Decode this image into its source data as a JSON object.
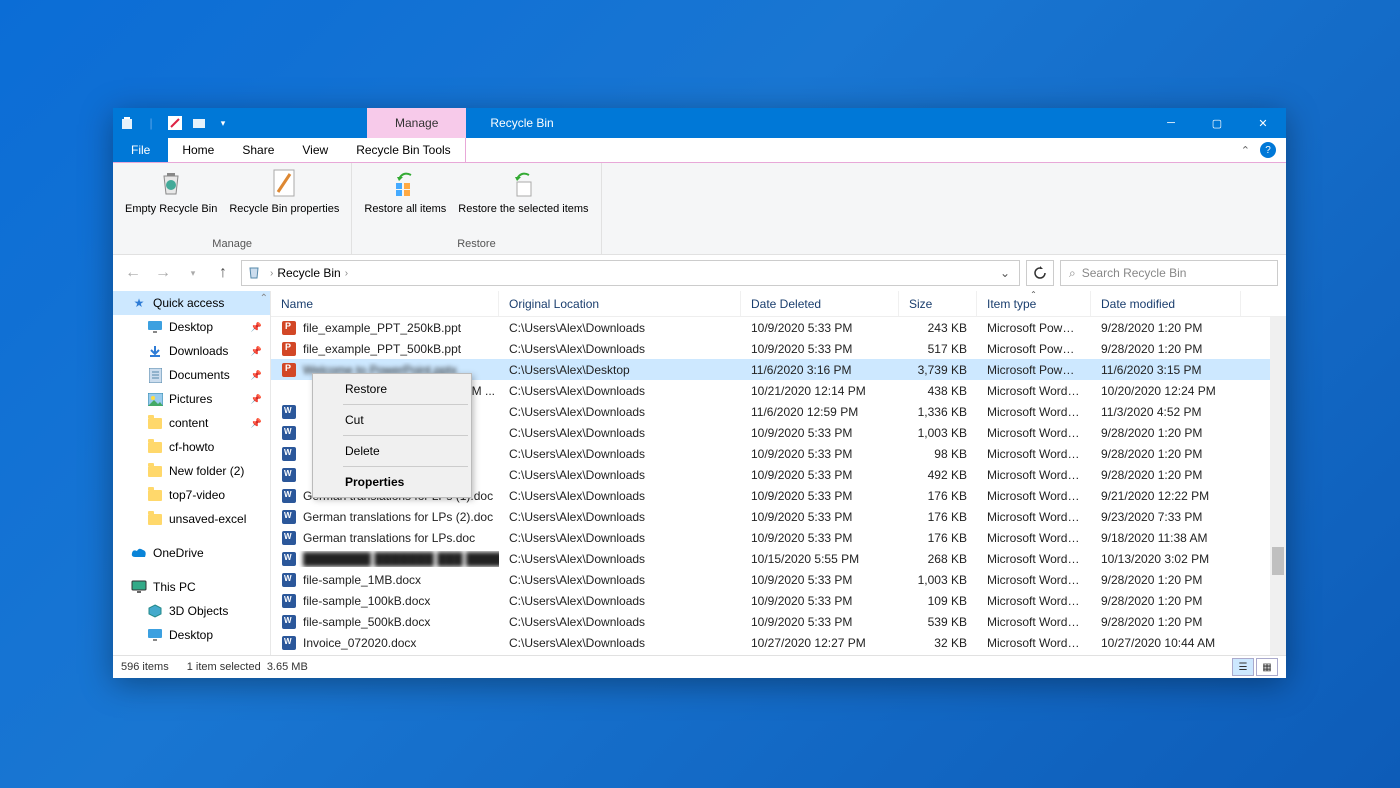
{
  "title": "Recycle Bin",
  "manage_tab": "Manage",
  "ribbon_tabs": {
    "file": "File",
    "home": "Home",
    "share": "Share",
    "view": "View",
    "tools": "Recycle Bin Tools"
  },
  "ribbon": {
    "empty": "Empty Recycle Bin",
    "props": "Recycle Bin properties",
    "restore_all": "Restore all items",
    "restore_sel": "Restore the selected items",
    "group_manage": "Manage",
    "group_restore": "Restore"
  },
  "breadcrumb": [
    "Recycle Bin"
  ],
  "search_placeholder": "Search Recycle Bin",
  "sidebar": {
    "quick": "Quick access",
    "items": [
      {
        "label": "Desktop",
        "icon": "desktop",
        "pin": true
      },
      {
        "label": "Downloads",
        "icon": "down",
        "pin": true
      },
      {
        "label": "Documents",
        "icon": "doc",
        "pin": true
      },
      {
        "label": "Pictures",
        "icon": "pic",
        "pin": true
      },
      {
        "label": "content",
        "icon": "folder",
        "pin": true
      },
      {
        "label": "cf-howto",
        "icon": "folder",
        "pin": false
      },
      {
        "label": "New folder (2)",
        "icon": "folder",
        "pin": false
      },
      {
        "label": "top7-video",
        "icon": "folder",
        "pin": false
      },
      {
        "label": "unsaved-excel",
        "icon": "folder",
        "pin": false
      }
    ],
    "onedrive": "OneDrive",
    "thispc": "This PC",
    "thispc_items": [
      {
        "label": "3D Objects",
        "icon": "3d"
      },
      {
        "label": "Desktop",
        "icon": "desktop"
      }
    ]
  },
  "columns": {
    "name": "Name",
    "loc": "Original Location",
    "del": "Date Deleted",
    "size": "Size",
    "type": "Item type",
    "mod": "Date modified"
  },
  "rows": [
    {
      "icon": "ppt",
      "name": "file_example_PPT_250kB.ppt",
      "loc": "C:\\Users\\Alex\\Downloads",
      "del": "10/9/2020 5:33 PM",
      "size": "243 KB",
      "type": "Microsoft PowerP...",
      "mod": "9/28/2020 1:20 PM",
      "sel": false
    },
    {
      "icon": "ppt",
      "name": "file_example_PPT_500kB.ppt",
      "loc": "C:\\Users\\Alex\\Downloads",
      "del": "10/9/2020 5:33 PM",
      "size": "517 KB",
      "type": "Microsoft PowerP...",
      "mod": "9/28/2020 1:20 PM",
      "sel": false
    },
    {
      "icon": "ppt",
      "name": "Welcome to PowerPoint.pptx",
      "loc": "C:\\Users\\Alex\\Desktop",
      "del": "11/6/2020 3:16 PM",
      "size": "3,739 KB",
      "type": "Microsoft PowerP...",
      "mod": "11/6/2020 3:15 PM",
      "sel": true,
      "blurname": true
    },
    {
      "icon": "doc",
      "name": "M ...",
      "loc": "C:\\Users\\Alex\\Downloads",
      "del": "10/21/2020 12:14 PM",
      "size": "438 KB",
      "type": "Microsoft Word 9...",
      "mod": "10/20/2020 12:24 PM",
      "sel": false,
      "blurname": true,
      "truncated": true
    },
    {
      "icon": "doc",
      "name": "",
      "loc": "C:\\Users\\Alex\\Downloads",
      "del": "11/6/2020 12:59 PM",
      "size": "1,336 KB",
      "type": "Microsoft Word 9...",
      "mod": "11/3/2020 4:52 PM",
      "sel": false,
      "hidden_by_menu": true
    },
    {
      "icon": "doc",
      "name": "",
      "loc": "C:\\Users\\Alex\\Downloads",
      "del": "10/9/2020 5:33 PM",
      "size": "1,003 KB",
      "type": "Microsoft Word 9...",
      "mod": "9/28/2020 1:20 PM",
      "sel": false,
      "hidden_by_menu": true
    },
    {
      "icon": "doc",
      "name": "",
      "loc": "C:\\Users\\Alex\\Downloads",
      "del": "10/9/2020 5:33 PM",
      "size": "98 KB",
      "type": "Microsoft Word 9...",
      "mod": "9/28/2020 1:20 PM",
      "sel": false,
      "hidden_by_menu": true
    },
    {
      "icon": "doc",
      "name": "",
      "loc": "C:\\Users\\Alex\\Downloads",
      "del": "10/9/2020 5:33 PM",
      "size": "492 KB",
      "type": "Microsoft Word 9...",
      "mod": "9/28/2020 1:20 PM",
      "sel": false,
      "hidden_by_menu": true
    },
    {
      "icon": "doc",
      "name": "German translations for LPs (1).doc",
      "loc": "C:\\Users\\Alex\\Downloads",
      "del": "10/9/2020 5:33 PM",
      "size": "176 KB",
      "type": "Microsoft Word 9...",
      "mod": "9/21/2020 12:22 PM",
      "sel": false
    },
    {
      "icon": "doc",
      "name": "German translations for LPs (2).doc",
      "loc": "C:\\Users\\Alex\\Downloads",
      "del": "10/9/2020 5:33 PM",
      "size": "176 KB",
      "type": "Microsoft Word 9...",
      "mod": "9/23/2020 7:33 PM",
      "sel": false
    },
    {
      "icon": "doc",
      "name": "German translations for LPs.doc",
      "loc": "C:\\Users\\Alex\\Downloads",
      "del": "10/9/2020 5:33 PM",
      "size": "176 KB",
      "type": "Microsoft Word 9...",
      "mod": "9/18/2020 11:38 AM",
      "sel": false
    },
    {
      "icon": "doc",
      "name": "",
      "loc": "C:\\Users\\Alex\\Downloads",
      "del": "10/15/2020 5:55 PM",
      "size": "268 KB",
      "type": "Microsoft Word 9...",
      "mod": "10/13/2020 3:02 PM",
      "sel": false,
      "blurname": true,
      "obscured": true
    },
    {
      "icon": "doc",
      "name": "file-sample_1MB.docx",
      "loc": "C:\\Users\\Alex\\Downloads",
      "del": "10/9/2020 5:33 PM",
      "size": "1,003 KB",
      "type": "Microsoft Word D...",
      "mod": "9/28/2020 1:20 PM",
      "sel": false
    },
    {
      "icon": "doc",
      "name": "file-sample_100kB.docx",
      "loc": "C:\\Users\\Alex\\Downloads",
      "del": "10/9/2020 5:33 PM",
      "size": "109 KB",
      "type": "Microsoft Word D...",
      "mod": "9/28/2020 1:20 PM",
      "sel": false
    },
    {
      "icon": "doc",
      "name": "file-sample_500kB.docx",
      "loc": "C:\\Users\\Alex\\Downloads",
      "del": "10/9/2020 5:33 PM",
      "size": "539 KB",
      "type": "Microsoft Word D...",
      "mod": "9/28/2020 1:20 PM",
      "sel": false
    },
    {
      "icon": "doc",
      "name": "Invoice_072020.docx",
      "loc": "C:\\Users\\Alex\\Downloads",
      "del": "10/27/2020 12:27 PM",
      "size": "32 KB",
      "type": "Microsoft Word D...",
      "mod": "10/27/2020 10:44 AM",
      "sel": false
    }
  ],
  "context_menu": [
    "Restore",
    "Cut",
    "Delete",
    "Properties"
  ],
  "status": {
    "count": "596 items",
    "sel": "1 item selected",
    "size": "3.65 MB"
  }
}
